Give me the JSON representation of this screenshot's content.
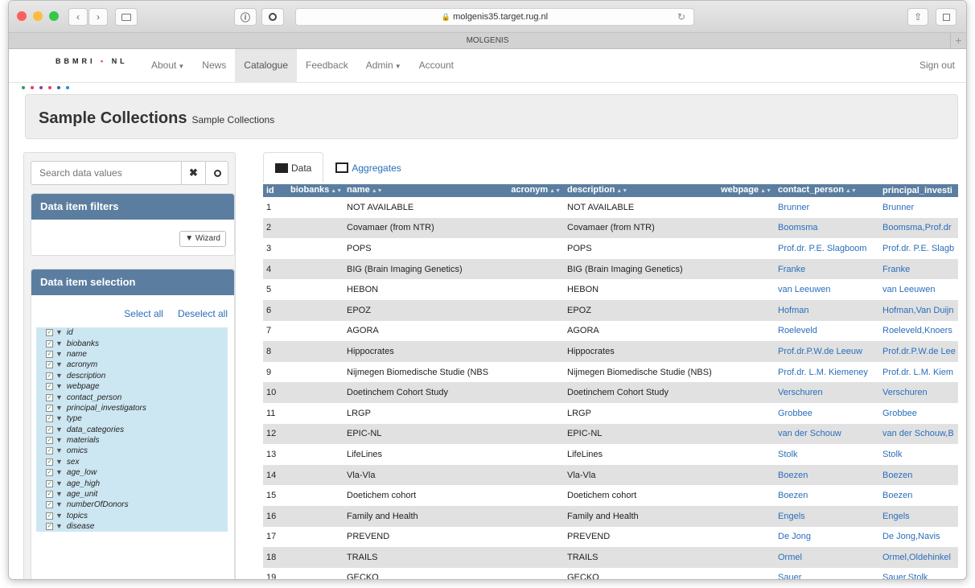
{
  "browser": {
    "url": "molgenis35.target.rug.nl",
    "tab_title": "MOLGENIS",
    "reload_icon": "reload-icon",
    "lock_icon": "lock-icon"
  },
  "navbar": {
    "logo_text": "BBMRI",
    "logo_dot": "•",
    "logo_suffix": "NL",
    "items": [
      {
        "label": "About",
        "dropdown": true
      },
      {
        "label": "News"
      },
      {
        "label": "Catalogue",
        "active": true
      },
      {
        "label": "Feedback"
      },
      {
        "label": "Admin",
        "dropdown": true
      },
      {
        "label": "Account"
      }
    ],
    "sign_out": "Sign out"
  },
  "header": {
    "title": "Sample Collections",
    "subtitle": "Sample Collections"
  },
  "search": {
    "placeholder": "Search data values",
    "clear_glyph": "✖",
    "search_glyph": "🔍"
  },
  "filters": {
    "title": "Data item filters",
    "wizard_label": "Wizard"
  },
  "selection": {
    "title": "Data item selection",
    "select_all": "Select all",
    "deselect_all": "Deselect all",
    "attributes": [
      "id",
      "biobanks",
      "name",
      "acronym",
      "description",
      "webpage",
      "contact_person",
      "principal_investigators",
      "type",
      "data_categories",
      "materials",
      "omics",
      "sex",
      "age_low",
      "age_high",
      "age_unit",
      "numberOfDonors",
      "topics",
      "disease"
    ]
  },
  "tabs": {
    "data": "Data",
    "aggregates": "Aggregates"
  },
  "table": {
    "columns": [
      "id",
      "biobanks",
      "name",
      "acronym",
      "description",
      "webpage",
      "contact_person",
      "principal_investi"
    ],
    "rows": [
      {
        "id": "1",
        "name": "NOT AVAILABLE",
        "description": "NOT AVAILABLE",
        "contact": "Brunner",
        "pi": "Brunner"
      },
      {
        "id": "2",
        "name": "Covamaer (from NTR)",
        "description": "Covamaer (from NTR)",
        "contact": "Boomsma",
        "pi": "Boomsma,Prof.dr"
      },
      {
        "id": "3",
        "name": "POPS",
        "description": "POPS",
        "contact": "Prof.dr. P.E. Slagboom",
        "pi": "Prof.dr. P.E. Slagb"
      },
      {
        "id": "4",
        "name": "BIG (Brain Imaging Genetics)",
        "description": "BIG (Brain Imaging Genetics)",
        "contact": "Franke",
        "pi": "Franke"
      },
      {
        "id": "5",
        "name": "HEBON",
        "description": "HEBON",
        "contact": "van Leeuwen",
        "pi": "van Leeuwen"
      },
      {
        "id": "6",
        "name": "EPOZ",
        "description": "EPOZ",
        "contact": "Hofman",
        "pi": "Hofman,Van Duijn"
      },
      {
        "id": "7",
        "name": "AGORA",
        "description": "AGORA",
        "contact": "Roeleveld",
        "pi": "Roeleveld,Knoers"
      },
      {
        "id": "8",
        "name": "Hippocrates",
        "description": "Hippocrates",
        "contact": "Prof.dr.P.W.de Leeuw",
        "pi": "Prof.dr.P.W.de Lee"
      },
      {
        "id": "9",
        "name": "Nijmegen Biomedische Studie (NBS)",
        "description": "Nijmegen Biomedische Studie (NBS)",
        "contact": "Prof.dr. L.M. Kiemeney",
        "pi": "Prof.dr. L.M. Kiem"
      },
      {
        "id": "10",
        "name": "Doetinchem Cohort Study",
        "description": "Doetinchem Cohort Study",
        "contact": "Verschuren",
        "pi": "Verschuren"
      },
      {
        "id": "11",
        "name": "LRGP",
        "description": "LRGP",
        "contact": "Grobbee",
        "pi": "Grobbee"
      },
      {
        "id": "12",
        "name": "EPIC-NL",
        "description": "EPIC-NL",
        "contact": "van der Schouw",
        "pi": "van der Schouw,B"
      },
      {
        "id": "13",
        "name": "LifeLines",
        "description": "LifeLines",
        "contact": "Stolk",
        "pi": "Stolk"
      },
      {
        "id": "14",
        "name": "Vla-Vla",
        "description": "Vla-Vla",
        "contact": "Boezen",
        "pi": "Boezen"
      },
      {
        "id": "15",
        "name": "Doetichem cohort",
        "description": "Doetichem cohort",
        "contact": "Boezen",
        "pi": "Boezen"
      },
      {
        "id": "16",
        "name": "Family and Health",
        "description": "Family and Health",
        "contact": "Engels",
        "pi": "Engels"
      },
      {
        "id": "17",
        "name": "PREVEND",
        "description": "PREVEND",
        "contact": "De Jong",
        "pi": "De Jong,Navis"
      },
      {
        "id": "18",
        "name": "TRAILS",
        "description": "TRAILS",
        "contact": "Ormel",
        "pi": "Ormel,Oldehinkel"
      },
      {
        "id": "19",
        "name": "GECKO",
        "description": "GECKO",
        "contact": "Sauer",
        "pi": "Sauer,Stolk"
      }
    ]
  },
  "colors": {
    "panel_header": "#5b7ea0",
    "link": "#2a6ebb",
    "selection_bg": "#cde7f2"
  }
}
